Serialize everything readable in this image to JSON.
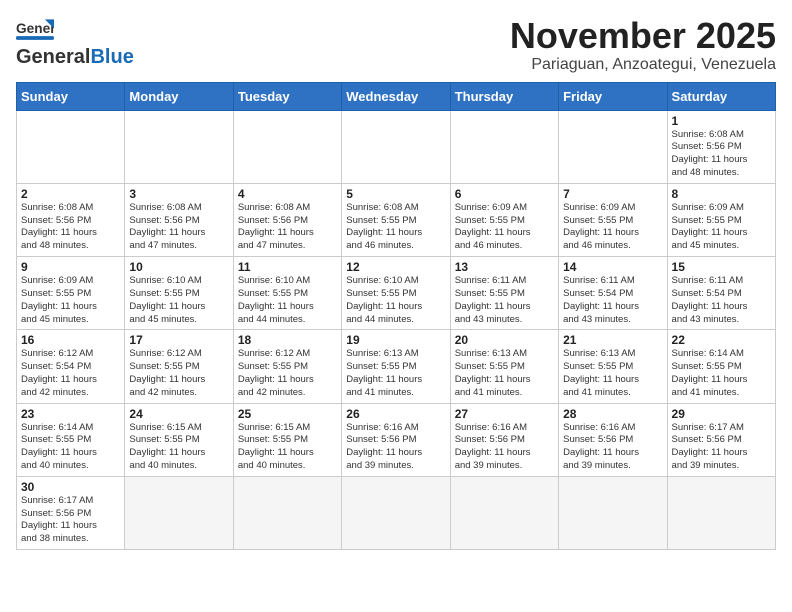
{
  "header": {
    "logo_text_general": "General",
    "logo_text_blue": "Blue",
    "month_title": "November 2025",
    "location": "Pariaguan, Anzoategui, Venezuela"
  },
  "days_of_week": [
    "Sunday",
    "Monday",
    "Tuesday",
    "Wednesday",
    "Thursday",
    "Friday",
    "Saturday"
  ],
  "weeks": [
    [
      {
        "day": "",
        "info": ""
      },
      {
        "day": "",
        "info": ""
      },
      {
        "day": "",
        "info": ""
      },
      {
        "day": "",
        "info": ""
      },
      {
        "day": "",
        "info": ""
      },
      {
        "day": "",
        "info": ""
      },
      {
        "day": "1",
        "info": "Sunrise: 6:08 AM\nSunset: 5:56 PM\nDaylight: 11 hours\nand 48 minutes."
      }
    ],
    [
      {
        "day": "2",
        "info": "Sunrise: 6:08 AM\nSunset: 5:56 PM\nDaylight: 11 hours\nand 48 minutes."
      },
      {
        "day": "3",
        "info": "Sunrise: 6:08 AM\nSunset: 5:56 PM\nDaylight: 11 hours\nand 47 minutes."
      },
      {
        "day": "4",
        "info": "Sunrise: 6:08 AM\nSunset: 5:56 PM\nDaylight: 11 hours\nand 47 minutes."
      },
      {
        "day": "5",
        "info": "Sunrise: 6:08 AM\nSunset: 5:55 PM\nDaylight: 11 hours\nand 46 minutes."
      },
      {
        "day": "6",
        "info": "Sunrise: 6:09 AM\nSunset: 5:55 PM\nDaylight: 11 hours\nand 46 minutes."
      },
      {
        "day": "7",
        "info": "Sunrise: 6:09 AM\nSunset: 5:55 PM\nDaylight: 11 hours\nand 46 minutes."
      },
      {
        "day": "8",
        "info": "Sunrise: 6:09 AM\nSunset: 5:55 PM\nDaylight: 11 hours\nand 45 minutes."
      }
    ],
    [
      {
        "day": "9",
        "info": "Sunrise: 6:09 AM\nSunset: 5:55 PM\nDaylight: 11 hours\nand 45 minutes."
      },
      {
        "day": "10",
        "info": "Sunrise: 6:10 AM\nSunset: 5:55 PM\nDaylight: 11 hours\nand 45 minutes."
      },
      {
        "day": "11",
        "info": "Sunrise: 6:10 AM\nSunset: 5:55 PM\nDaylight: 11 hours\nand 44 minutes."
      },
      {
        "day": "12",
        "info": "Sunrise: 6:10 AM\nSunset: 5:55 PM\nDaylight: 11 hours\nand 44 minutes."
      },
      {
        "day": "13",
        "info": "Sunrise: 6:11 AM\nSunset: 5:55 PM\nDaylight: 11 hours\nand 43 minutes."
      },
      {
        "day": "14",
        "info": "Sunrise: 6:11 AM\nSunset: 5:54 PM\nDaylight: 11 hours\nand 43 minutes."
      },
      {
        "day": "15",
        "info": "Sunrise: 6:11 AM\nSunset: 5:54 PM\nDaylight: 11 hours\nand 43 minutes."
      }
    ],
    [
      {
        "day": "16",
        "info": "Sunrise: 6:12 AM\nSunset: 5:54 PM\nDaylight: 11 hours\nand 42 minutes."
      },
      {
        "day": "17",
        "info": "Sunrise: 6:12 AM\nSunset: 5:55 PM\nDaylight: 11 hours\nand 42 minutes."
      },
      {
        "day": "18",
        "info": "Sunrise: 6:12 AM\nSunset: 5:55 PM\nDaylight: 11 hours\nand 42 minutes."
      },
      {
        "day": "19",
        "info": "Sunrise: 6:13 AM\nSunset: 5:55 PM\nDaylight: 11 hours\nand 41 minutes."
      },
      {
        "day": "20",
        "info": "Sunrise: 6:13 AM\nSunset: 5:55 PM\nDaylight: 11 hours\nand 41 minutes."
      },
      {
        "day": "21",
        "info": "Sunrise: 6:13 AM\nSunset: 5:55 PM\nDaylight: 11 hours\nand 41 minutes."
      },
      {
        "day": "22",
        "info": "Sunrise: 6:14 AM\nSunset: 5:55 PM\nDaylight: 11 hours\nand 41 minutes."
      }
    ],
    [
      {
        "day": "23",
        "info": "Sunrise: 6:14 AM\nSunset: 5:55 PM\nDaylight: 11 hours\nand 40 minutes."
      },
      {
        "day": "24",
        "info": "Sunrise: 6:15 AM\nSunset: 5:55 PM\nDaylight: 11 hours\nand 40 minutes."
      },
      {
        "day": "25",
        "info": "Sunrise: 6:15 AM\nSunset: 5:55 PM\nDaylight: 11 hours\nand 40 minutes."
      },
      {
        "day": "26",
        "info": "Sunrise: 6:16 AM\nSunset: 5:56 PM\nDaylight: 11 hours\nand 39 minutes."
      },
      {
        "day": "27",
        "info": "Sunrise: 6:16 AM\nSunset: 5:56 PM\nDaylight: 11 hours\nand 39 minutes."
      },
      {
        "day": "28",
        "info": "Sunrise: 6:16 AM\nSunset: 5:56 PM\nDaylight: 11 hours\nand 39 minutes."
      },
      {
        "day": "29",
        "info": "Sunrise: 6:17 AM\nSunset: 5:56 PM\nDaylight: 11 hours\nand 39 minutes."
      }
    ],
    [
      {
        "day": "30",
        "info": "Sunrise: 6:17 AM\nSunset: 5:56 PM\nDaylight: 11 hours\nand 38 minutes."
      },
      {
        "day": "",
        "info": ""
      },
      {
        "day": "",
        "info": ""
      },
      {
        "day": "",
        "info": ""
      },
      {
        "day": "",
        "info": ""
      },
      {
        "day": "",
        "info": ""
      },
      {
        "day": "",
        "info": ""
      }
    ]
  ]
}
